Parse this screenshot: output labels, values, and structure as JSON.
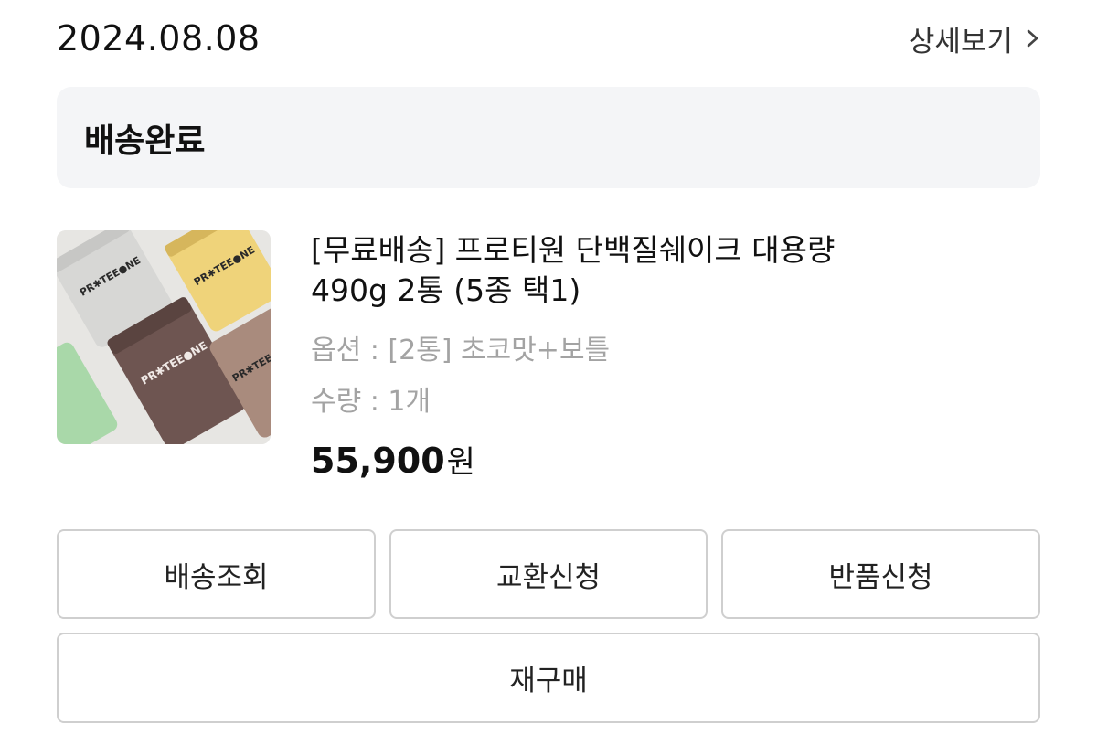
{
  "order": {
    "date": "2024.08.08",
    "detail_label": "상세보기"
  },
  "status": {
    "label": "배송완료"
  },
  "product": {
    "title_line1": "[무료배송] 프로티원 단백질쉐이크 대용량",
    "title_line2": "490g 2통 (5종 택1)",
    "option": "옵션 : [2통] 초코맛+보틀",
    "quantity": "수량 : 1개",
    "price": "55,900",
    "currency": "원",
    "image_brand_text": "PR✱TEE●NE"
  },
  "actions": {
    "track": "배송조회",
    "exchange": "교환신청",
    "return": "반품신청",
    "reorder": "재구매"
  },
  "icons": {
    "detail_chevron": "chevron-right-icon"
  }
}
